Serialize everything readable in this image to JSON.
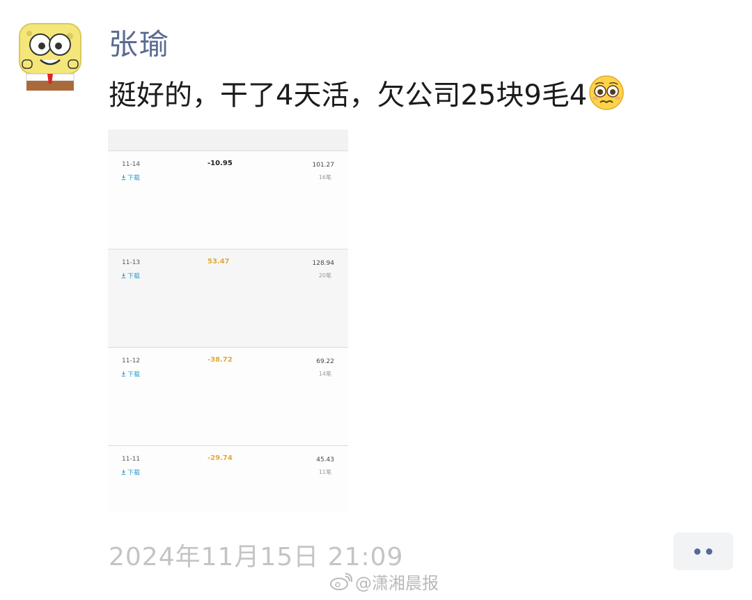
{
  "post": {
    "username": "张瑜",
    "text": "挺好的，干了4天活，欠公司25块9毛4",
    "emoji_icon": "pleading-face-emoji",
    "timestamp": "2024年11月15日 21:09"
  },
  "screenshot": {
    "download_label": "下载",
    "records": [
      {
        "date": "11-14",
        "amount": "-10.95",
        "total": "101.27",
        "count": "16笔",
        "amount_color": "#222222"
      },
      {
        "date": "11-13",
        "amount": "53.47",
        "total": "128.94",
        "count": "20笔",
        "amount_color": "#e3a93a"
      },
      {
        "date": "11-12",
        "amount": "-38.72",
        "total": "69.22",
        "count": "14笔",
        "amount_color": "#e3a93a"
      },
      {
        "date": "11-11",
        "amount": "-29.74",
        "total": "45.43",
        "count": "11笔",
        "amount_color": "#e3a93a"
      }
    ]
  },
  "watermark": {
    "text": "@潇湘晨报",
    "icon": "weibo-icon"
  },
  "colors": {
    "username": "#5a6b92",
    "timestamp": "#c4c4c4",
    "more_dots": "#536a9a",
    "download_link": "#2e9bc7"
  }
}
